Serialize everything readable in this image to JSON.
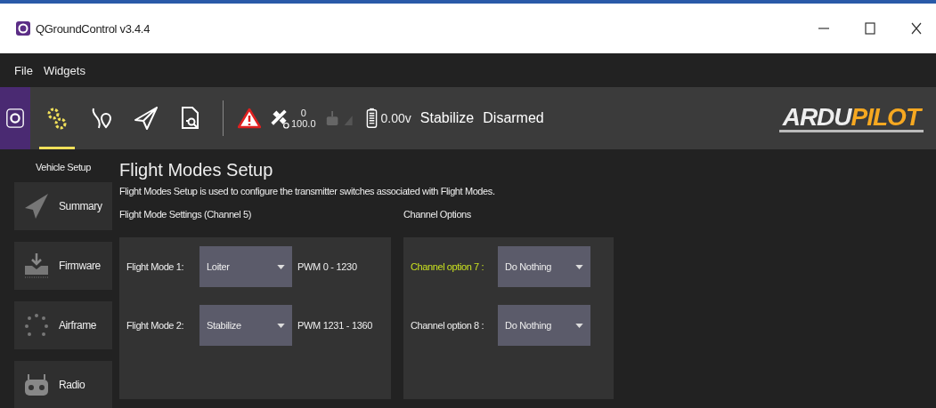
{
  "window": {
    "title": "QGroundControl v3.4.4"
  },
  "menu_bar": [
    "File",
    "Widgets"
  ],
  "toolbar": {
    "buttons": [
      {
        "kind": "app",
        "selected": false
      },
      {
        "kind": "setup",
        "selected": true
      },
      {
        "kind": "plan",
        "selected": false
      },
      {
        "kind": "fly",
        "selected": false
      },
      {
        "kind": "analyze",
        "selected": false
      }
    ],
    "gps": {
      "count": "0",
      "hdop": "100.0"
    },
    "battery": "0.00v",
    "flight_mode": "Stabilize",
    "arm_state": "Disarmed",
    "logo": {
      "part_1": "ARDU",
      "part_2": "PILOT"
    }
  },
  "sidebar": {
    "title": "Vehicle Setup",
    "items": [
      {
        "kind": "summary",
        "label": "Summary"
      },
      {
        "kind": "firmware",
        "label": "Firmware"
      },
      {
        "kind": "airframe",
        "label": "Airframe"
      },
      {
        "kind": "radio",
        "label": "Radio"
      }
    ]
  },
  "page": {
    "title": "Flight Modes Setup",
    "description": "Flight Modes Setup is used to configure the transmitter switches associated with Flight Modes.",
    "flight_modes": {
      "heading": "Flight Mode Settings (Channel 5)",
      "rows": [
        {
          "label": "Flight Mode 1:",
          "value": "Loiter",
          "pwm": "PWM 0 - 1230"
        },
        {
          "label": "Flight Mode 2:",
          "value": "Stabilize",
          "pwm": "PWM 1231 - 1360"
        }
      ]
    },
    "channel_options": {
      "heading": "Channel Options",
      "rows": [
        {
          "label": "Channel option 7 :",
          "value": "Do Nothing",
          "active": true
        },
        {
          "label": "Channel option 8 :",
          "value": "Do Nothing",
          "active": false
        }
      ]
    }
  }
}
